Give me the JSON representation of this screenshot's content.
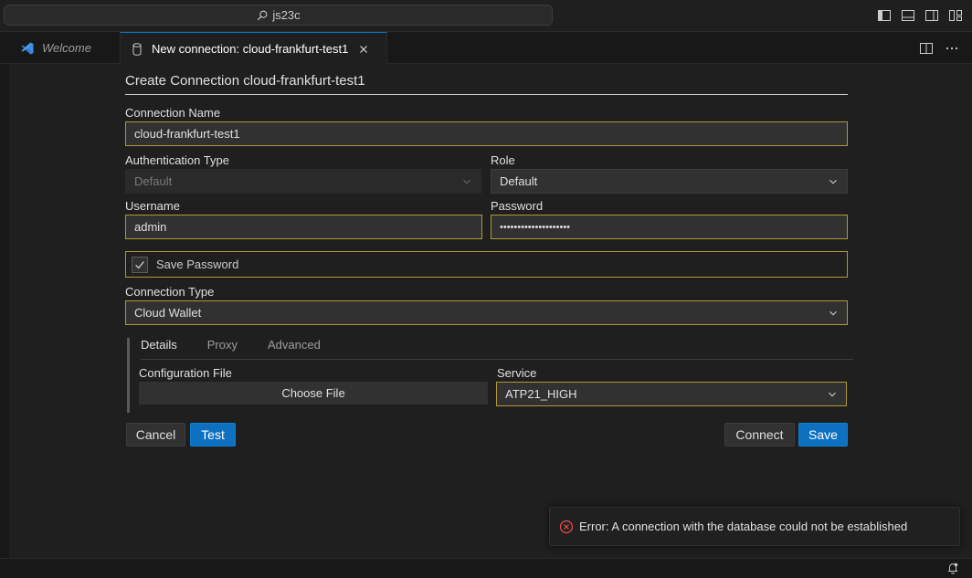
{
  "titlebar": {
    "search_text": "js23c"
  },
  "tabs": [
    {
      "label": "Welcome"
    },
    {
      "label": "New connection: cloud-frankfurt-test1"
    }
  ],
  "form": {
    "heading": "Create Connection cloud-frankfurt-test1",
    "connection_name_label": "Connection Name",
    "connection_name_value": "cloud-frankfurt-test1",
    "auth_type_label": "Authentication Type",
    "auth_type_value": "Default",
    "role_label": "Role",
    "role_value": "Default",
    "username_label": "Username",
    "username_value": "admin",
    "password_label": "Password",
    "password_value": "••••••••••••••••••••",
    "save_password_label": "Save Password",
    "connection_type_label": "Connection Type",
    "connection_type_value": "Cloud Wallet",
    "subtabs": [
      "Details",
      "Proxy",
      "Advanced"
    ],
    "config_file_label": "Configuration File",
    "choose_file_label": "Choose File",
    "service_label": "Service",
    "service_value": "ATP21_HIGH"
  },
  "buttons": {
    "cancel": "Cancel",
    "test": "Test",
    "connect": "Connect",
    "save": "Save"
  },
  "notification": {
    "message": "Error: A connection with the database could not be established"
  },
  "colors": {
    "accent": "#0e70c0",
    "focus_border": "#b09836",
    "error": "#f14c4c",
    "vscode_blue": "#3c8fe0"
  }
}
